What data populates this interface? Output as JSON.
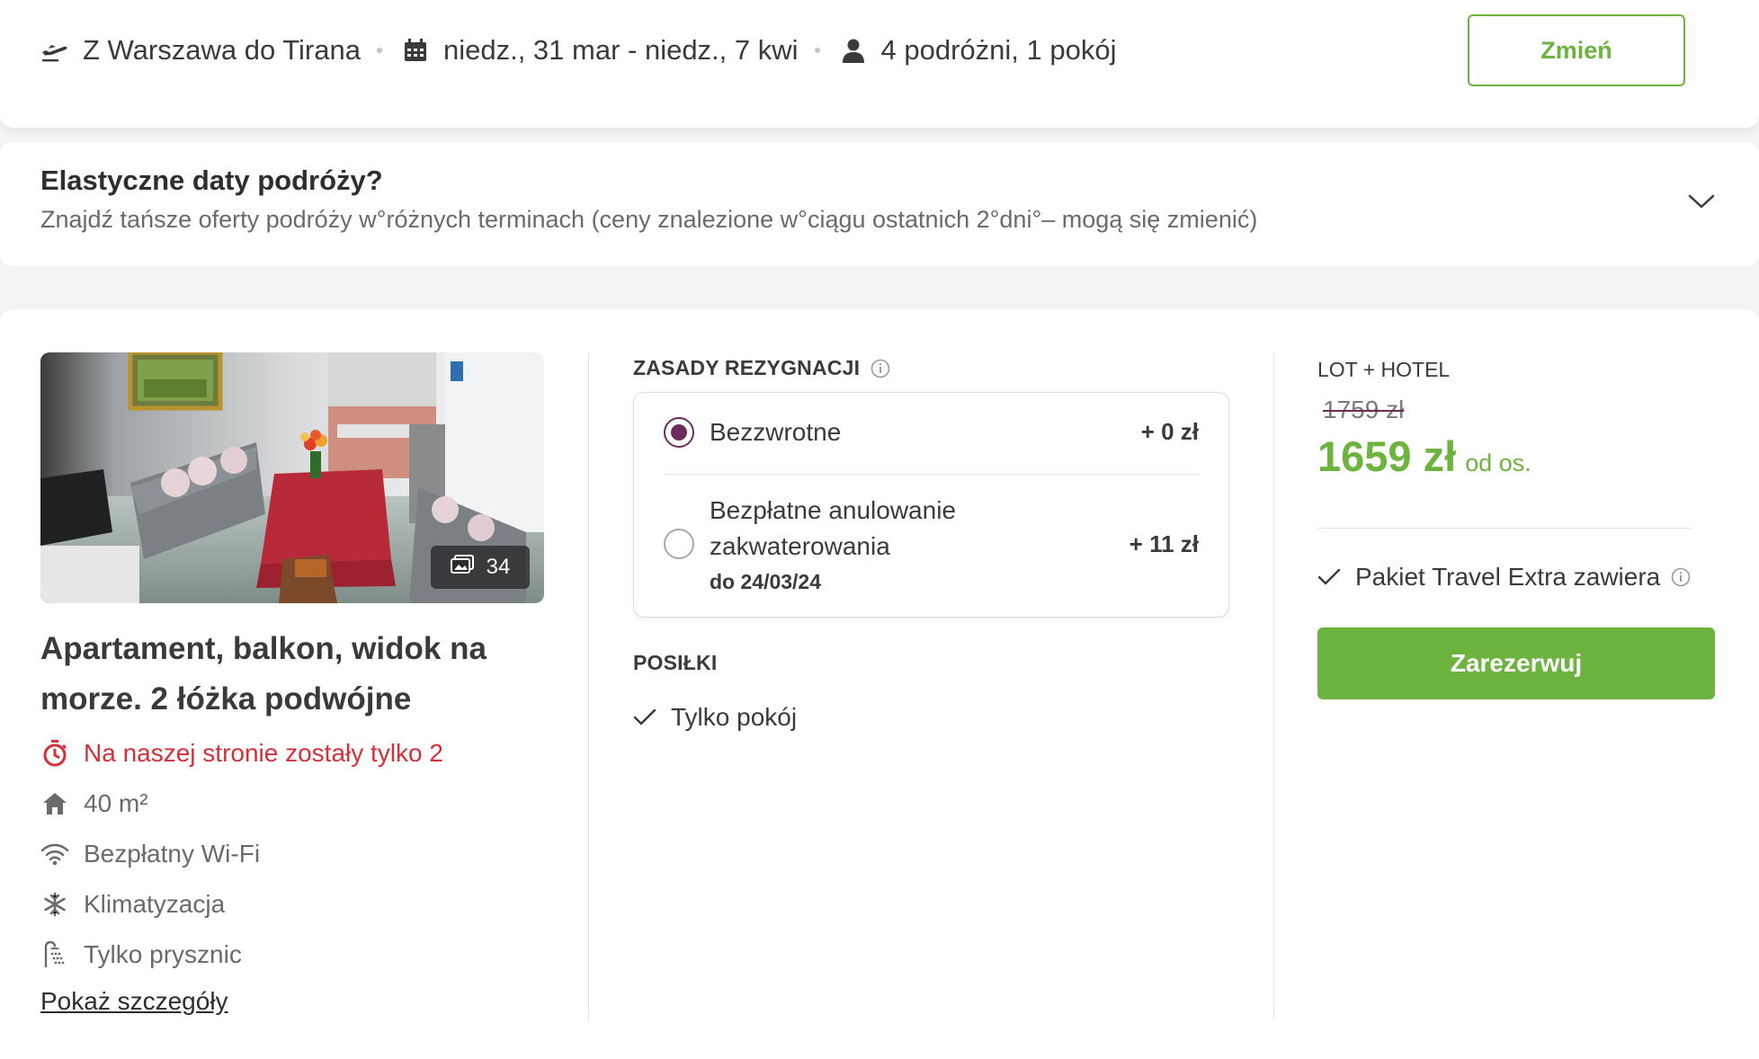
{
  "header": {
    "route": "Z Warszawa do Tirana",
    "dates": "niedz., 31 mar - niedz., 7 kwi",
    "travellers": "4 podróżni, 1 pokój",
    "change_label": "Zmień"
  },
  "flex_dates": {
    "title": "Elastyczne daty podróży?",
    "subtitle": "Znajdź tańsze oferty podróży w°różnych terminach (ceny znalezione w°ciągu ostatnich 2°dni°– mogą się zmienić)"
  },
  "offer": {
    "photo_count": "34",
    "room_title": "Apartament, balkon, widok na morze. 2 łóżka podwójne",
    "availability_alert": "Na naszej stronie zostały tylko 2",
    "features": [
      {
        "icon": "house-icon",
        "label": "40 m²"
      },
      {
        "icon": "wifi-icon",
        "label": "Bezpłatny Wi-Fi"
      },
      {
        "icon": "snowflake-icon",
        "label": "Klimatyzacja"
      },
      {
        "icon": "shower-icon",
        "label": "Tylko prysznic"
      }
    ],
    "details_link": "Pokaż szczegóły"
  },
  "cancellation": {
    "section_label": "ZASADY REZYGNACJI",
    "options": [
      {
        "label": "Bezzwrotne",
        "price": "+ 0 zł",
        "selected": true
      },
      {
        "label_line1": "Bezpłatne anulowanie",
        "label_line2": "zakwaterowania",
        "sub": "do 24/03/24",
        "price": "+ 11 zł",
        "selected": false
      }
    ]
  },
  "meals": {
    "section_label": "POSIŁKI",
    "item": "Tylko pokój"
  },
  "pricing": {
    "package_label": "LOT + HOTEL",
    "old_price": "1759 zł",
    "new_price": "1659 zł",
    "per_person": "od os.",
    "extra_label": "Pakiet Travel Extra zawiera",
    "book_label": "Zarezerwuj"
  },
  "colors": {
    "accent_green": "#6cb33f",
    "radio_purple": "#6b2c5c",
    "alert_red": "#d4303a"
  }
}
